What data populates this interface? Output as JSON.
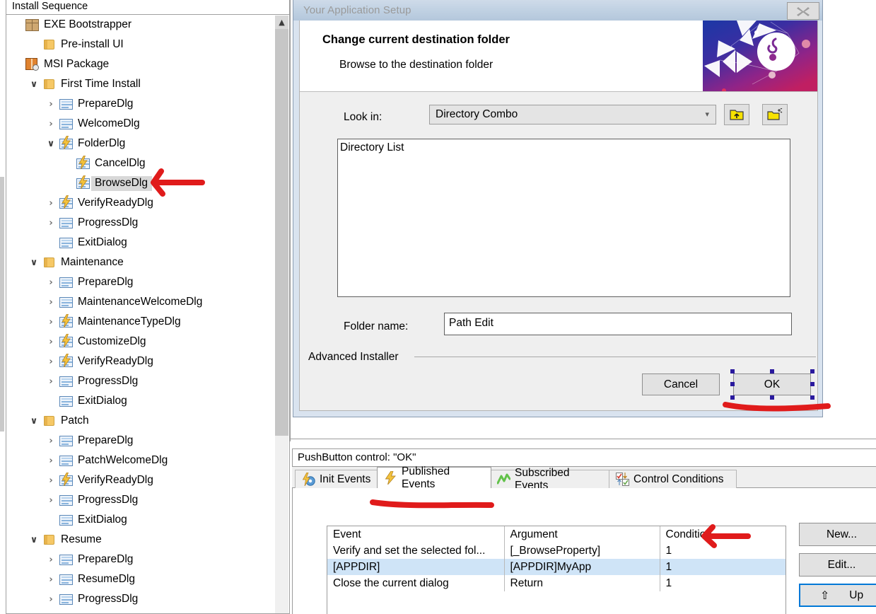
{
  "tree": {
    "header": "Install Sequence",
    "selected": "BrowseDlg",
    "items": [
      {
        "label": "EXE Bootstrapper",
        "icon": "package-icon",
        "indent": 0,
        "chevron": "none"
      },
      {
        "label": "Pre-install UI",
        "icon": "folder-icon",
        "indent": 1,
        "chevron": "none"
      },
      {
        "label": "MSI Package",
        "icon": "msi-package-icon",
        "indent": 0,
        "chevron": "none"
      },
      {
        "label": "First Time Install",
        "icon": "folder-icon",
        "indent": 1,
        "chevron": "expanded"
      },
      {
        "label": "PrepareDlg",
        "icon": "dialog-icon",
        "indent": 2,
        "chevron": "collapsed"
      },
      {
        "label": "WelcomeDlg",
        "icon": "dialog-icon",
        "indent": 2,
        "chevron": "collapsed"
      },
      {
        "label": "FolderDlg",
        "icon": "dialog-event-icon",
        "indent": 2,
        "chevron": "expanded"
      },
      {
        "label": "CancelDlg",
        "icon": "dialog-event-icon",
        "indent": 3,
        "chevron": "none"
      },
      {
        "label": "BrowseDlg",
        "icon": "dialog-event-icon",
        "indent": 3,
        "chevron": "none"
      },
      {
        "label": "VerifyReadyDlg",
        "icon": "dialog-event-icon",
        "indent": 2,
        "chevron": "collapsed"
      },
      {
        "label": "ProgressDlg",
        "icon": "dialog-icon",
        "indent": 2,
        "chevron": "collapsed"
      },
      {
        "label": "ExitDialog",
        "icon": "dialog-icon",
        "indent": 2,
        "chevron": "none"
      },
      {
        "label": "Maintenance",
        "icon": "folder-icon",
        "indent": 1,
        "chevron": "expanded"
      },
      {
        "label": "PrepareDlg",
        "icon": "dialog-icon",
        "indent": 2,
        "chevron": "collapsed"
      },
      {
        "label": "MaintenanceWelcomeDlg",
        "icon": "dialog-icon",
        "indent": 2,
        "chevron": "collapsed"
      },
      {
        "label": "MaintenanceTypeDlg",
        "icon": "dialog-event-icon",
        "indent": 2,
        "chevron": "collapsed"
      },
      {
        "label": "CustomizeDlg",
        "icon": "dialog-event-icon",
        "indent": 2,
        "chevron": "collapsed"
      },
      {
        "label": "VerifyReadyDlg",
        "icon": "dialog-event-icon",
        "indent": 2,
        "chevron": "collapsed"
      },
      {
        "label": "ProgressDlg",
        "icon": "dialog-icon",
        "indent": 2,
        "chevron": "collapsed"
      },
      {
        "label": "ExitDialog",
        "icon": "dialog-icon",
        "indent": 2,
        "chevron": "none"
      },
      {
        "label": "Patch",
        "icon": "folder-icon",
        "indent": 1,
        "chevron": "expanded"
      },
      {
        "label": "PrepareDlg",
        "icon": "dialog-icon",
        "indent": 2,
        "chevron": "collapsed"
      },
      {
        "label": "PatchWelcomeDlg",
        "icon": "dialog-icon",
        "indent": 2,
        "chevron": "collapsed"
      },
      {
        "label": "VerifyReadyDlg",
        "icon": "dialog-event-icon",
        "indent": 2,
        "chevron": "collapsed"
      },
      {
        "label": "ProgressDlg",
        "icon": "dialog-icon",
        "indent": 2,
        "chevron": "collapsed"
      },
      {
        "label": "ExitDialog",
        "icon": "dialog-icon",
        "indent": 2,
        "chevron": "none"
      },
      {
        "label": "Resume",
        "icon": "folder-icon",
        "indent": 1,
        "chevron": "expanded"
      },
      {
        "label": "PrepareDlg",
        "icon": "dialog-icon",
        "indent": 2,
        "chevron": "collapsed"
      },
      {
        "label": "ResumeDlg",
        "icon": "dialog-icon",
        "indent": 2,
        "chevron": "collapsed"
      },
      {
        "label": "ProgressDlg",
        "icon": "dialog-icon",
        "indent": 2,
        "chevron": "collapsed"
      }
    ]
  },
  "dialog": {
    "title": "Your Application Setup",
    "close_label": "close-icon",
    "heading": "Change current destination folder",
    "subheading": "Browse to the destination folder",
    "look_in_label": "Look in:",
    "look_in_value": "Directory Combo",
    "up_one_level_icon": "folder-up-icon",
    "new_folder_icon": "new-folder-icon",
    "directory_list_value": "Directory List",
    "folder_name_label": "Folder name:",
    "path_edit_value": "Path Edit",
    "group_label": "Advanced Installer",
    "cancel_label": "Cancel",
    "ok_label": "OK"
  },
  "bottom": {
    "status": "PushButton control: \"OK\"",
    "tabs": [
      {
        "label": "Init Events",
        "icon": "init-events-icon",
        "active": false
      },
      {
        "label": "Published Events",
        "icon": "published-events-icon",
        "active": true
      },
      {
        "label": "Subscribed Events",
        "icon": "subscribed-events-icon",
        "active": false
      },
      {
        "label": "Control Conditions",
        "icon": "control-conditions-icon",
        "active": false
      }
    ],
    "table": {
      "columns": [
        "Event",
        "Argument",
        "Condition"
      ],
      "rows": [
        {
          "event": "Verify and set the selected fol...",
          "argument": "[_BrowseProperty]",
          "condition": "1",
          "selected": false
        },
        {
          "event": "[APPDIR]",
          "argument": "[APPDIR]MyApp",
          "condition": "1",
          "selected": true
        },
        {
          "event": "Close the current dialog",
          "argument": "Return",
          "condition": "1",
          "selected": false
        }
      ]
    },
    "buttons": {
      "new": "New...",
      "edit": "Edit...",
      "up": "Up",
      "up_icon": "arrow-up-icon"
    }
  },
  "colors": {
    "accent": "#0078d7",
    "annotation": "#e01b1b",
    "selection_handle": "#2a1a9e",
    "row_selected": "#cfe4f7",
    "tree_selected": "#d8d8d8"
  }
}
